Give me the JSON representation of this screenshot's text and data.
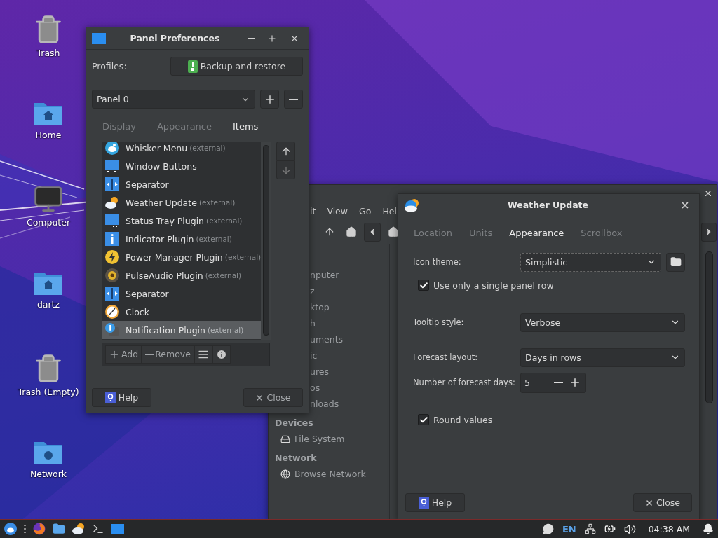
{
  "desktop_icons": [
    {
      "kind": "trash",
      "label": "Trash"
    },
    {
      "kind": "home",
      "label": "Home"
    },
    {
      "kind": "computer",
      "label": "Computer"
    },
    {
      "kind": "home",
      "label": "dartz"
    },
    {
      "kind": "trash",
      "label": "Trash (Empty)"
    },
    {
      "kind": "network",
      "label": "Network"
    }
  ],
  "file_manager": {
    "menu": [
      "it",
      "View",
      "Go",
      "Hel"
    ],
    "sidebar": [
      {
        "kind": "clipped",
        "label": "nputer"
      },
      {
        "kind": "clipped",
        "label": "z"
      },
      {
        "kind": "clipped",
        "label": "ktop"
      },
      {
        "kind": "clipped",
        "label": "h"
      },
      {
        "kind": "clipped",
        "label": "uments"
      },
      {
        "kind": "clipped",
        "label": "ic"
      },
      {
        "kind": "clipped",
        "label": "ures"
      },
      {
        "kind": "clipped",
        "label": "os"
      },
      {
        "kind": "clipped",
        "label": "nloads"
      },
      {
        "kind": "heading",
        "label": "Devices"
      },
      {
        "kind": "drive",
        "label": "File System"
      },
      {
        "kind": "heading",
        "label": "Network"
      },
      {
        "kind": "network",
        "label": "Browse Network"
      }
    ]
  },
  "panel_preferences": {
    "title": "Panel Preferences",
    "profiles_label": "Profiles:",
    "backup_button": "Backup and restore",
    "panel_select": "Panel 0",
    "tabs": [
      {
        "label": "Display",
        "selected": false
      },
      {
        "label": "Appearance",
        "selected": false
      },
      {
        "label": "Items",
        "selected": true
      }
    ],
    "items": [
      {
        "kind": "whisker",
        "label": "Whisker Menu",
        "note": "(external)",
        "selected": false
      },
      {
        "kind": "window",
        "label": "Window Buttons",
        "selected": false
      },
      {
        "kind": "separator",
        "label": "Separator",
        "selected": false
      },
      {
        "kind": "weather",
        "label": "Weather Update",
        "note": "(external)",
        "selected": false
      },
      {
        "kind": "tray",
        "label": "Status Tray Plugin",
        "note": "(external)",
        "selected": false
      },
      {
        "kind": "indicator",
        "label": "Indicator Plugin",
        "note": "(external)",
        "selected": false
      },
      {
        "kind": "power",
        "label": "Power Manager Plugin",
        "note": "(external)",
        "selected": false
      },
      {
        "kind": "audio",
        "label": "PulseAudio Plugin",
        "note": "(external)",
        "selected": false
      },
      {
        "kind": "separator",
        "label": "Separator",
        "selected": false
      },
      {
        "kind": "clock",
        "label": "Clock",
        "selected": false
      },
      {
        "kind": "notification",
        "label": "Notification Plugin",
        "note": "(external)",
        "selected": true
      }
    ],
    "add_button": "Add",
    "remove_button": "Remove",
    "help_button": "Help",
    "close_button": "Close"
  },
  "weather_update": {
    "title": "Weather Update",
    "tabs": [
      {
        "label": "Location",
        "selected": false
      },
      {
        "label": "Units",
        "selected": false
      },
      {
        "label": "Appearance",
        "selected": true
      },
      {
        "label": "Scrollbox",
        "selected": false
      }
    ],
    "rows": [
      {
        "kind": "select",
        "label": "Icon theme:",
        "value": "Simplistic",
        "folder": true
      },
      {
        "kind": "check",
        "label": "Use only a single panel row",
        "checked": true
      },
      {
        "kind": "select",
        "label": "Tooltip style:",
        "value": "Verbose"
      },
      {
        "kind": "select",
        "label": "Forecast layout:",
        "value": "Days in rows"
      },
      {
        "kind": "spin",
        "label": "Number of forecast days:",
        "value": "5"
      },
      {
        "kind": "check",
        "label": "Round values",
        "checked": true
      }
    ],
    "help_button": "Help",
    "close_button": "Close"
  },
  "taskbar": {
    "keyboard_layout": "EN",
    "clock": "04:38 AM"
  }
}
